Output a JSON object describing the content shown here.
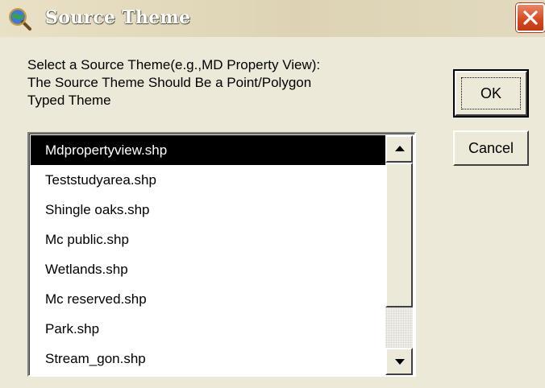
{
  "window": {
    "title": "Source Theme",
    "app_icon": "globe-magnifier-icon",
    "close_icon": "close-icon",
    "close_color": "#d3481f"
  },
  "prompt": {
    "text": "Select a Source Theme(e.g.,MD Property View):\nThe Source Theme Should Be a Point/Polygon\nTyped Theme"
  },
  "list": {
    "items": [
      {
        "label": "Mdpropertyview.shp",
        "selected": true
      },
      {
        "label": "Teststudyarea.shp",
        "selected": false
      },
      {
        "label": "Shingle oaks.shp",
        "selected": false
      },
      {
        "label": "Mc public.shp",
        "selected": false
      },
      {
        "label": "Wetlands.shp",
        "selected": false
      },
      {
        "label": "Mc reserved.shp",
        "selected": false
      },
      {
        "label": "Park.shp",
        "selected": false
      },
      {
        "label": "Stream_gon.shp",
        "selected": false
      }
    ],
    "selection_color": "#000000"
  },
  "buttons": {
    "ok_label": "OK",
    "cancel_label": "Cancel"
  }
}
